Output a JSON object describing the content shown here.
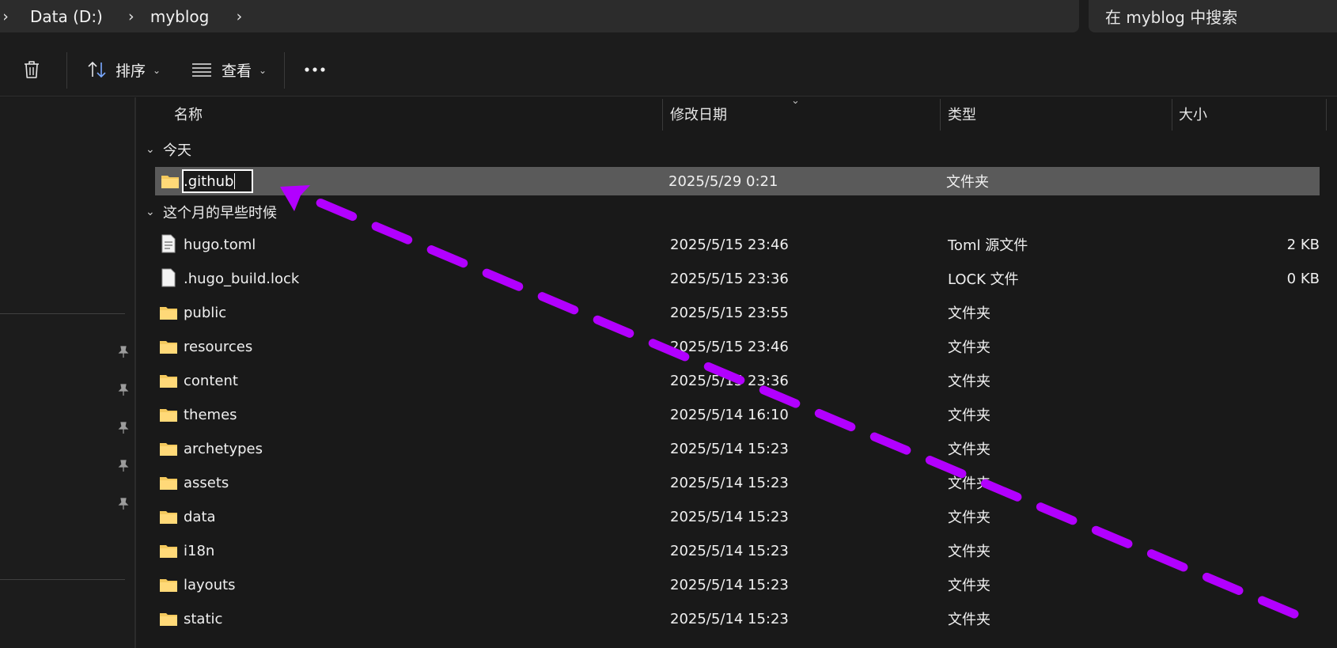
{
  "address": {
    "drive": "Data (D:)",
    "folder": "myblog",
    "search_placeholder": "在 myblog 中搜索"
  },
  "toolbar": {
    "sort_label": "排序",
    "view_label": "查看"
  },
  "columns": {
    "name": "名称",
    "modified": "修改日期",
    "type": "类型",
    "size": "大小"
  },
  "groups": {
    "today": "今天",
    "earlier": "这个月的早些时候"
  },
  "today_items": [
    {
      "name": ".github",
      "date": "2025/5/29 0:21",
      "type": "文件夹",
      "size": "",
      "icon": "folder-icon"
    }
  ],
  "earlier_items": [
    {
      "name": "hugo.toml",
      "date": "2025/5/15 23:46",
      "type": "Toml 源文件",
      "size": "2 KB",
      "icon": "document-icon"
    },
    {
      "name": ".hugo_build.lock",
      "date": "2025/5/15 23:36",
      "type": "LOCK 文件",
      "size": "0 KB",
      "icon": "file-icon"
    },
    {
      "name": "public",
      "date": "2025/5/15 23:55",
      "type": "文件夹",
      "size": "",
      "icon": "folder-icon"
    },
    {
      "name": "resources",
      "date": "2025/5/15 23:46",
      "type": "文件夹",
      "size": "",
      "icon": "folder-icon"
    },
    {
      "name": "content",
      "date": "2025/5/15 23:36",
      "type": "文件夹",
      "size": "",
      "icon": "folder-icon"
    },
    {
      "name": "themes",
      "date": "2025/5/14 16:10",
      "type": "文件夹",
      "size": "",
      "icon": "folder-icon"
    },
    {
      "name": "archetypes",
      "date": "2025/5/14 15:23",
      "type": "文件夹",
      "size": "",
      "icon": "folder-icon"
    },
    {
      "name": "assets",
      "date": "2025/5/14 15:23",
      "type": "文件夹",
      "size": "",
      "icon": "folder-icon"
    },
    {
      "name": "data",
      "date": "2025/5/14 15:23",
      "type": "文件夹",
      "size": "",
      "icon": "folder-icon"
    },
    {
      "name": "i18n",
      "date": "2025/5/14 15:23",
      "type": "文件夹",
      "size": "",
      "icon": "folder-icon"
    },
    {
      "name": "layouts",
      "date": "2025/5/14 15:23",
      "type": "文件夹",
      "size": "",
      "icon": "folder-icon"
    },
    {
      "name": "static",
      "date": "2025/5/14 15:23",
      "type": "文件夹",
      "size": "",
      "icon": "folder-icon"
    }
  ],
  "colors": {
    "annotation": "#b200ff",
    "selection": "#5a5a5a",
    "folder": "#f4c95d"
  }
}
